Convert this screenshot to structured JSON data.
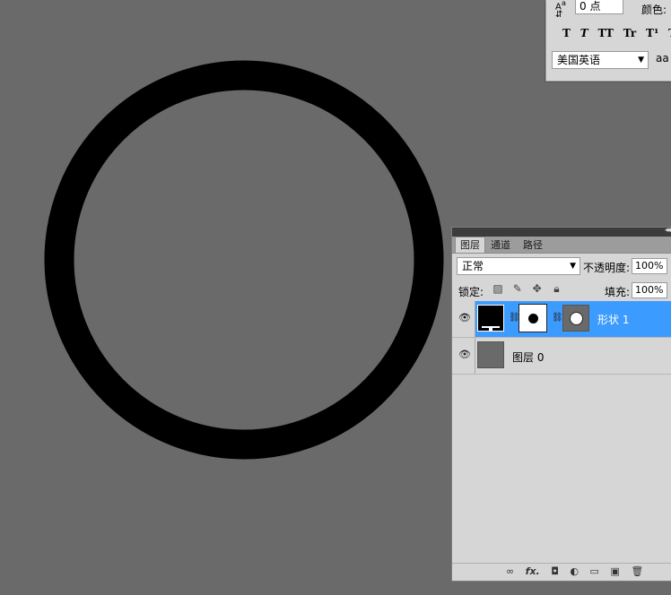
{
  "canvas": {
    "background_color": "#6a6a6a",
    "ring_color": "#000000"
  },
  "character_panel": {
    "kerning_value": "0 点",
    "color_label": "颜色:",
    "style_buttons": [
      "T",
      "T",
      "TT",
      "Tr",
      "T¹",
      "T"
    ],
    "language": "美国英语",
    "aa_label": "aa"
  },
  "layers_panel": {
    "tabs": [
      {
        "label": "图层",
        "active": true
      },
      {
        "label": "通道",
        "active": false
      },
      {
        "label": "路径",
        "active": false
      }
    ],
    "blend_mode": "正常",
    "opacity_label": "不透明度:",
    "opacity_value": "100%",
    "lock_label": "锁定:",
    "fill_label": "填充:",
    "fill_value": "100%",
    "layers": [
      {
        "name": "形状 1",
        "selected": true
      },
      {
        "name": "图层 0",
        "selected": false
      }
    ],
    "bottom_icons": [
      "link-icon",
      "fx-icon",
      "mask-icon",
      "adjustment-icon",
      "group-icon",
      "new-layer-icon",
      "trash-icon"
    ],
    "bottom_glyphs": [
      "∞",
      "fx.",
      "◘",
      "◐",
      "▭",
      "▣",
      "🗑"
    ],
    "selected_color": "#3c9bff"
  }
}
